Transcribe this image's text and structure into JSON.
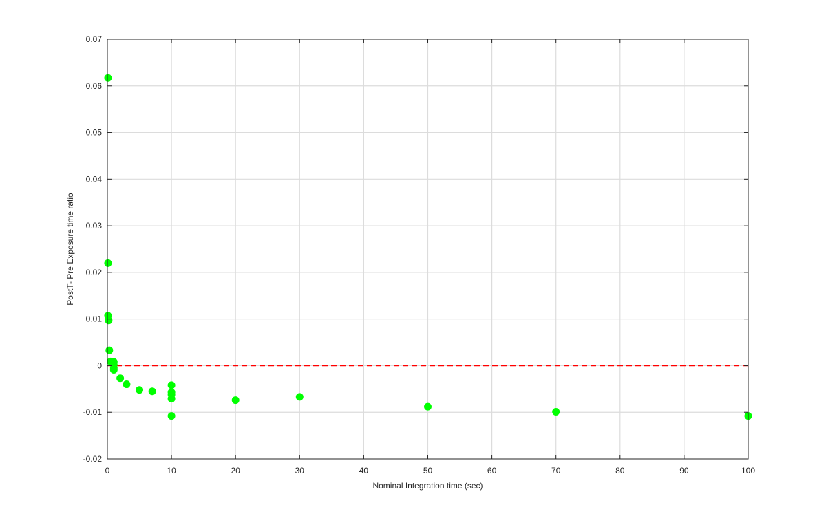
{
  "chart_data": {
    "type": "scatter",
    "xlabel": "Nominal Integration time (sec)",
    "ylabel": "PostT- Pre Exposure time ratio",
    "xlim": [
      0,
      100
    ],
    "ylim": [
      -0.02,
      0.07
    ],
    "x_ticks": [
      "0",
      "10",
      "20",
      "30",
      "40",
      "50",
      "60",
      "70",
      "80",
      "90",
      "100"
    ],
    "y_ticks": [
      "-0.02",
      "-0.01",
      "0",
      "0.01",
      "0.02",
      "0.03",
      "0.04",
      "0.05",
      "0.06",
      "0.07"
    ],
    "grid": true,
    "marker_color": "#00ff00",
    "reference_line": {
      "y": 0,
      "color": "#ff0000",
      "style": "dashed"
    },
    "points": [
      {
        "x": 0.1,
        "y": 0.0617
      },
      {
        "x": 0.1,
        "y": 0.022
      },
      {
        "x": 0.1,
        "y": 0.0107
      },
      {
        "x": 0.2,
        "y": 0.0097
      },
      {
        "x": 0.3,
        "y": 0.0033
      },
      {
        "x": 0.5,
        "y": 0.0009
      },
      {
        "x": 1.0,
        "y": 0.0008
      },
      {
        "x": 1.0,
        "y": 0.0002
      },
      {
        "x": 1.0,
        "y": -0.0005
      },
      {
        "x": 1.0,
        "y": -0.0009
      },
      {
        "x": 2.0,
        "y": -0.0027
      },
      {
        "x": 3.0,
        "y": -0.004
      },
      {
        "x": 5.0,
        "y": -0.0052
      },
      {
        "x": 7.0,
        "y": -0.0055
      },
      {
        "x": 10.0,
        "y": -0.0042
      },
      {
        "x": 10.0,
        "y": -0.0057
      },
      {
        "x": 10.0,
        "y": -0.0062
      },
      {
        "x": 10.0,
        "y": -0.0071
      },
      {
        "x": 10.0,
        "y": -0.0108
      },
      {
        "x": 20.0,
        "y": -0.0074
      },
      {
        "x": 30.0,
        "y": -0.0067
      },
      {
        "x": 50.0,
        "y": -0.0088
      },
      {
        "x": 70.0,
        "y": -0.0099
      },
      {
        "x": 100.0,
        "y": -0.0108
      }
    ]
  }
}
